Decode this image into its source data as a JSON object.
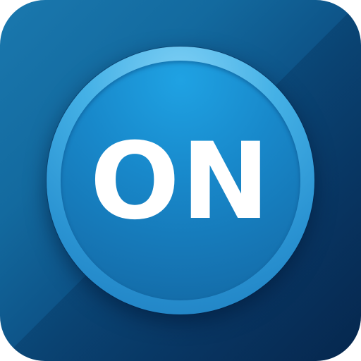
{
  "icon": {
    "label": "ON",
    "colors": {
      "background_top": "#1a78ae",
      "background_bottom": "#082e58",
      "ring": "#45b1e6",
      "disc": "#1888ca",
      "text": "#ffffff"
    }
  }
}
